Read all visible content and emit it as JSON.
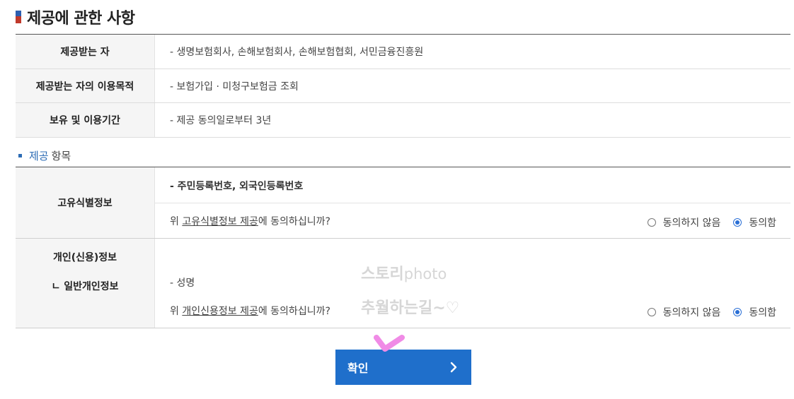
{
  "section": {
    "title": "제공에 관한 사항"
  },
  "info_table": {
    "rows": [
      {
        "label": "제공받는 자",
        "value": "- 생명보험회사, 손해보험회사, 손해보험협회, 서민금융진흥원"
      },
      {
        "label": "제공받는 자의 이용목적",
        "value": "- 보험가입 · 미청구보험금 조회"
      },
      {
        "label": "보유 및 이용기간",
        "value": "- 제공 동의일로부터 3년"
      }
    ]
  },
  "items_section": {
    "title_blue": "제공",
    "title_rest": "항목"
  },
  "items": [
    {
      "label": "고유식별정보",
      "detail": "- 주민등록번호, 외국인등록번호",
      "question_prefix": "위 ",
      "question_link": "고유식별정보 제공",
      "question_suffix": "에 동의하십니까?",
      "option_disagree": "동의하지 않음",
      "option_agree": "동의함",
      "selected": "agree"
    },
    {
      "label": "개인(신용)정보",
      "sub_label": "ㄴ 일반개인정보",
      "detail": "- 성명",
      "question_prefix": "위 ",
      "question_link": "개인신용정보 제공",
      "question_suffix": "에 동의하십니까?",
      "option_disagree": "동의하지 않음",
      "option_agree": "동의함",
      "selected": "agree"
    }
  ],
  "watermark": {
    "line1_main": "스토리",
    "line1_photo": "photo",
    "line2": "추월하는길~♡"
  },
  "confirm_button": {
    "label": "확인"
  },
  "colors": {
    "accent_blue": "#1f6fcb",
    "radio_blue": "#2a6fd6",
    "header_bg": "#f5f5f5",
    "check_pink": "#f08be6"
  },
  "icons": {
    "confirm_arrow": "chevron-right-icon",
    "check_mark": "checkmark-icon"
  }
}
